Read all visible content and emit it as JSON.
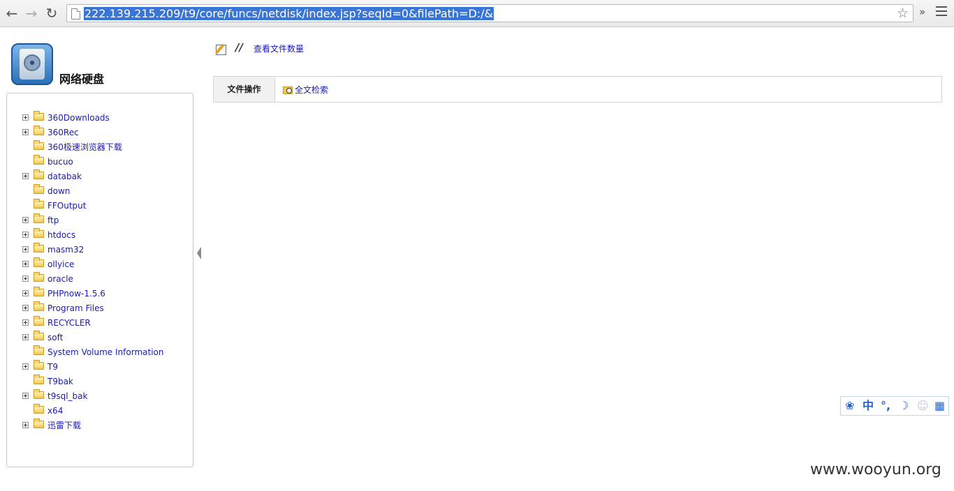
{
  "browser": {
    "url": "222.139.215.209/t9/core/funcs/netdisk/index.jsp?seqId=0&filePath=D:/&",
    "back_glyph": "←",
    "forward_glyph": "→",
    "reload_glyph": "↻",
    "star_glyph": "☆",
    "extensions_glyph": "»",
    "icons": [
      "back-arrow-icon",
      "forward-arrow-icon",
      "reload-icon",
      "page-icon",
      "bookmark-star-icon",
      "chrome-menu-icon"
    ]
  },
  "sidebar": {
    "title": "网络硬盘",
    "tree": [
      {
        "label": "360Downloads",
        "expandable": true
      },
      {
        "label": "360Rec",
        "expandable": true
      },
      {
        "label": "360极速浏览器下载",
        "expandable": false
      },
      {
        "label": "bucuo",
        "expandable": false
      },
      {
        "label": "databak",
        "expandable": true
      },
      {
        "label": "down",
        "expandable": false
      },
      {
        "label": "FFOutput",
        "expandable": false
      },
      {
        "label": "ftp",
        "expandable": true
      },
      {
        "label": "htdocs",
        "expandable": true
      },
      {
        "label": "masm32",
        "expandable": true
      },
      {
        "label": "ollyice",
        "expandable": true
      },
      {
        "label": "oracle",
        "expandable": true
      },
      {
        "label": "PHPnow-1.5.6",
        "expandable": true
      },
      {
        "label": "Program Files",
        "expandable": true
      },
      {
        "label": "RECYCLER",
        "expandable": true
      },
      {
        "label": "soft",
        "expandable": true
      },
      {
        "label": "System Volume Information",
        "expandable": false
      },
      {
        "label": "T9",
        "expandable": true
      },
      {
        "label": "T9bak",
        "expandable": false
      },
      {
        "label": "t9sql_bak",
        "expandable": true
      },
      {
        "label": "x64",
        "expandable": false
      },
      {
        "label": "迅雷下载",
        "expandable": true
      }
    ]
  },
  "main": {
    "separator": "//",
    "count_link": "查看文件数量",
    "ops_label": "文件操作",
    "fulltext_search": "全文检索"
  },
  "ime": {
    "items": [
      "❀",
      "中",
      "°,",
      "☽",
      "☺",
      "▦"
    ]
  },
  "watermark": "www.wooyun.org",
  "colors": {
    "link": "#1a1ab0",
    "url_highlight": "#3875d7",
    "ime_blue": "#2a62c9"
  }
}
